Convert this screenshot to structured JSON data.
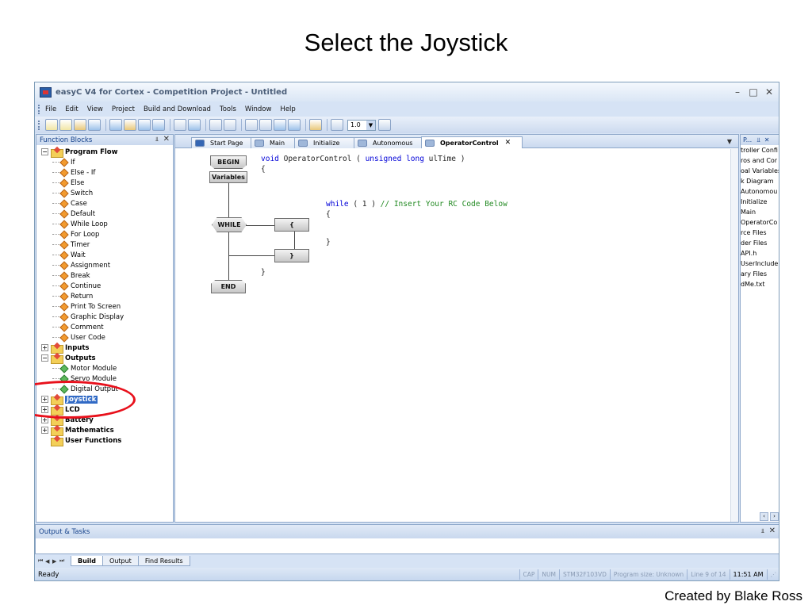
{
  "slide": {
    "title": "Select the Joystick",
    "credit": "Created by Blake Ross"
  },
  "window": {
    "title": "easyC V4 for Cortex - Competition Project - Untitled"
  },
  "menu": [
    "File",
    "Edit",
    "View",
    "Project",
    "Build and Download",
    "Tools",
    "Window",
    "Help"
  ],
  "toolbar": {
    "zoom_value": "1.0"
  },
  "function_blocks": {
    "title": "Function Blocks",
    "tree": [
      {
        "label": "Program Flow",
        "type": "folder",
        "expanded": true
      },
      {
        "label": "If",
        "type": "leaf"
      },
      {
        "label": "Else - If",
        "type": "leaf"
      },
      {
        "label": "Else",
        "type": "leaf"
      },
      {
        "label": "Switch",
        "type": "leaf"
      },
      {
        "label": "Case",
        "type": "leaf"
      },
      {
        "label": "Default",
        "type": "leaf"
      },
      {
        "label": "While Loop",
        "type": "leaf"
      },
      {
        "label": "For Loop",
        "type": "leaf"
      },
      {
        "label": "Timer",
        "type": "leaf"
      },
      {
        "label": "Wait",
        "type": "leaf"
      },
      {
        "label": "Assignment",
        "type": "leaf"
      },
      {
        "label": "Break",
        "type": "leaf"
      },
      {
        "label": "Continue",
        "type": "leaf"
      },
      {
        "label": "Return",
        "type": "leaf"
      },
      {
        "label": "Print To Screen",
        "type": "leaf"
      },
      {
        "label": "Graphic Display",
        "type": "leaf"
      },
      {
        "label": "Comment",
        "type": "leaf"
      },
      {
        "label": "User Code",
        "type": "leaf"
      },
      {
        "label": "Inputs",
        "type": "folder",
        "expanded": false
      },
      {
        "label": "Outputs",
        "type": "folder",
        "expanded": true
      },
      {
        "label": "Motor Module",
        "type": "leaf-green"
      },
      {
        "label": "Servo Module",
        "type": "leaf-green"
      },
      {
        "label": "Digital Output",
        "type": "leaf-green"
      },
      {
        "label": "Joystick",
        "type": "folder",
        "expanded": false,
        "selected": true
      },
      {
        "label": "LCD",
        "type": "folder",
        "expanded": false
      },
      {
        "label": "Battery",
        "type": "folder",
        "expanded": false
      },
      {
        "label": "Mathematics",
        "type": "folder",
        "expanded": false
      },
      {
        "label": "User Functions",
        "type": "folder",
        "expanded": null
      }
    ]
  },
  "tabs": [
    {
      "label": "Start Page"
    },
    {
      "label": "Main"
    },
    {
      "label": "Initialize"
    },
    {
      "label": "Autonomous"
    },
    {
      "label": "OperatorControl",
      "active": true
    }
  ],
  "flow": {
    "begin": "BEGIN",
    "variables": "Variables",
    "while": "WHILE",
    "open": "{",
    "close": "}",
    "end": "END"
  },
  "code": {
    "l1_void": "void",
    "l1_name": " OperatorControl ( ",
    "l1_kw1": "unsigned",
    "l1_kw2": "long",
    "l1_rest": " ulTime )",
    "l2": "{",
    "l3_kw": "while",
    "l3_mid": " ( 1 ) ",
    "l3_comment": "// Insert Your RC Code Below",
    "l4": "{",
    "l5": "}",
    "l6": "}"
  },
  "project_panel": {
    "title": "P...",
    "items": [
      "troller Confi",
      "ros and Cor",
      "oal Variables",
      "k Diagram",
      "Autonomou",
      "Initialize",
      "Main",
      "OperatorCo",
      "rce Files",
      "der Files",
      "API.h",
      "UserInclude",
      "ary Files",
      "dMe.txt"
    ]
  },
  "output": {
    "title": "Output & Tasks",
    "tabs": [
      {
        "label": "Build",
        "active": true
      },
      {
        "label": "Output"
      },
      {
        "label": "Find Results"
      }
    ]
  },
  "status": {
    "ready": "Ready",
    "cap": "CAP",
    "num": "NUM",
    "device": "STM32F103VD",
    "program_size": "Program size: Unknown",
    "line": "Line   9  of   14",
    "time": "11:51 AM"
  }
}
